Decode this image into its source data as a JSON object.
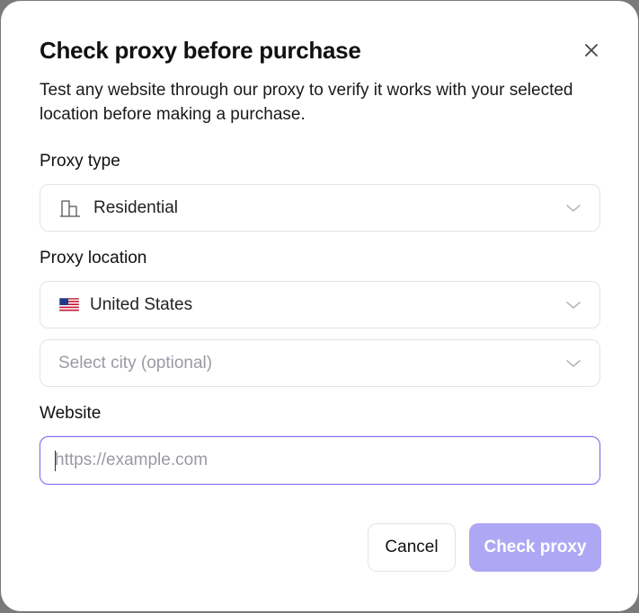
{
  "dialog": {
    "title": "Check proxy before purchase",
    "description": "Test any website through our proxy to verify it works with your selected location before making a purchase."
  },
  "proxy_type": {
    "label": "Proxy type",
    "selected": "Residential",
    "icon": "building-icon"
  },
  "proxy_location": {
    "label": "Proxy location",
    "country": "United States",
    "country_icon": "us-flag-icon",
    "city_placeholder": "Select city (optional)"
  },
  "website": {
    "label": "Website",
    "value": "",
    "placeholder": "https://example.com"
  },
  "actions": {
    "cancel_label": "Cancel",
    "check_label": "Check proxy"
  },
  "colors": {
    "accent": "#7b6ef0",
    "primary_button_disabled": "#aea8f4",
    "border": "#e3e3e8",
    "placeholder": "#9a9aa6"
  }
}
